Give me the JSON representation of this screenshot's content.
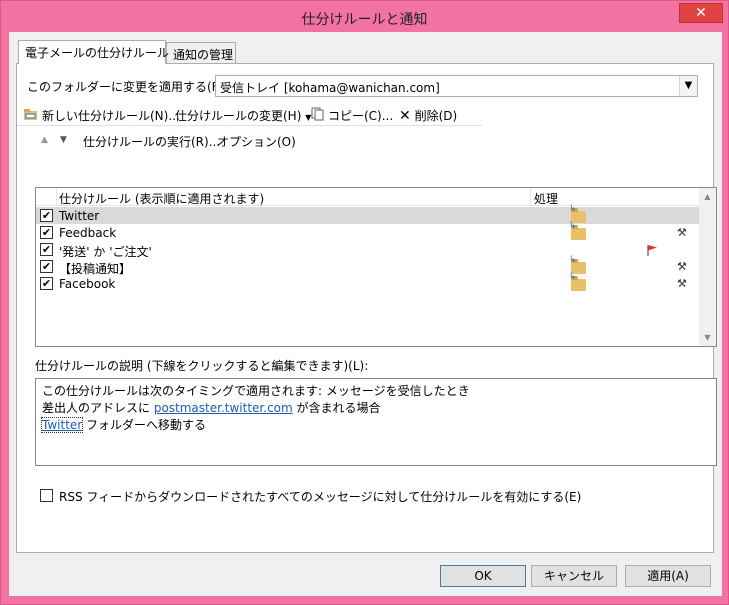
{
  "window": {
    "title": "仕分けルールと通知",
    "close_icon": "close-icon"
  },
  "tabs": [
    {
      "label": "電子メールの仕分けルール",
      "active": true
    },
    {
      "label": "通知の管理",
      "active": false
    }
  ],
  "folder_apply": {
    "label": "このフォルダーに変更を適用する(F):",
    "value": "受信トレイ [kohama@wanichan.com]"
  },
  "toolbar": {
    "new_rule": "新しい仕分けルール(N)...",
    "change_rule": "仕分けルールの変更(H)",
    "copy": "コピー(C)...",
    "delete": "削除(D)",
    "run_rules": "仕分けルールの実行(R)...",
    "options": "オプション(O)"
  },
  "rules_list": {
    "col_rule": "仕分けルール (表示順に適用されます)",
    "col_action": "処理",
    "rows": [
      {
        "name": "Twitter",
        "checked": true,
        "selected": true,
        "actions": [
          "move-to-folder-icon"
        ]
      },
      {
        "name": "Feedback",
        "checked": true,
        "selected": false,
        "actions": [
          "move-to-folder-icon",
          "tools-icon"
        ]
      },
      {
        "name": "'発送' か 'ご注文'",
        "checked": true,
        "selected": false,
        "actions": [
          "flag-icon"
        ]
      },
      {
        "name": "【投稿通知】",
        "checked": true,
        "selected": false,
        "actions": [
          "move-to-folder-icon",
          "tools-icon"
        ]
      },
      {
        "name": "Facebook",
        "checked": true,
        "selected": false,
        "actions": [
          "move-to-folder-icon",
          "tools-icon"
        ]
      }
    ]
  },
  "description": {
    "label": "仕分けルールの説明 (下線をクリックすると編集できます)(L):",
    "line1": "この仕分けルールは次のタイミングで適用されます: メッセージを受信したとき",
    "line2_prefix": "差出人のアドレスに ",
    "line2_link": "postmaster.twitter.com",
    "line2_suffix": " が含まれる場合",
    "line3_link": "Twitter",
    "line3_suffix": " フォルダーへ移動する"
  },
  "rss": {
    "label": "RSS フィードからダウンロードされたすべてのメッセージに対して仕分けルールを有効にする(E)",
    "checked": false
  },
  "buttons": {
    "ok": "OK",
    "cancel": "キャンセル",
    "apply": "適用(A)"
  },
  "colors": {
    "window_frame": "#f272a2",
    "close_button": "#e04343",
    "link": "#1a5fb4",
    "selected_row": "#d9d9d9"
  }
}
